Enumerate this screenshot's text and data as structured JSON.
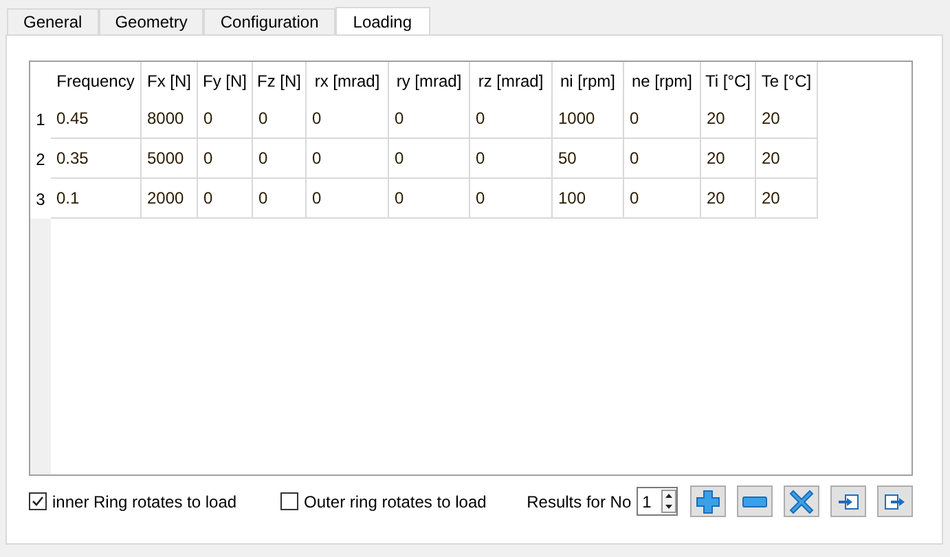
{
  "tabs": [
    {
      "label": "General",
      "selected": false
    },
    {
      "label": "Geometry",
      "selected": false
    },
    {
      "label": "Configuration",
      "selected": false
    },
    {
      "label": "Loading",
      "selected": true
    }
  ],
  "table": {
    "columns": [
      "Frequency",
      "Fx [N]",
      "Fy [N]",
      "Fz [N]",
      "rx [mrad]",
      "ry [mrad]",
      "rz [mrad]",
      "ni [rpm]",
      "ne [rpm]",
      "Ti [°C]",
      "Te [°C]"
    ],
    "rows": [
      {
        "number": "1",
        "cells": [
          "0.45",
          "8000",
          "0",
          "0",
          "0",
          "0",
          "0",
          "1000",
          "0",
          "20",
          "20"
        ]
      },
      {
        "number": "2",
        "cells": [
          "0.35",
          "5000",
          "0",
          "0",
          "0",
          "0",
          "0",
          "50",
          "0",
          "20",
          "20"
        ]
      },
      {
        "number": "3",
        "cells": [
          "0.1",
          "2000",
          "0",
          "0",
          "0",
          "0",
          "0",
          "100",
          "0",
          "20",
          "20"
        ]
      }
    ]
  },
  "options": [
    {
      "label": "inner Ring rotates to load",
      "checked": true
    },
    {
      "label": "Outer ring rotates to load",
      "checked": false
    }
  ],
  "results": {
    "label": "Results for No",
    "value": "1"
  },
  "buttons": [
    {
      "kind": "add"
    },
    {
      "kind": "remove"
    },
    {
      "kind": "delete"
    },
    {
      "kind": "import"
    },
    {
      "kind": "export"
    }
  ]
}
